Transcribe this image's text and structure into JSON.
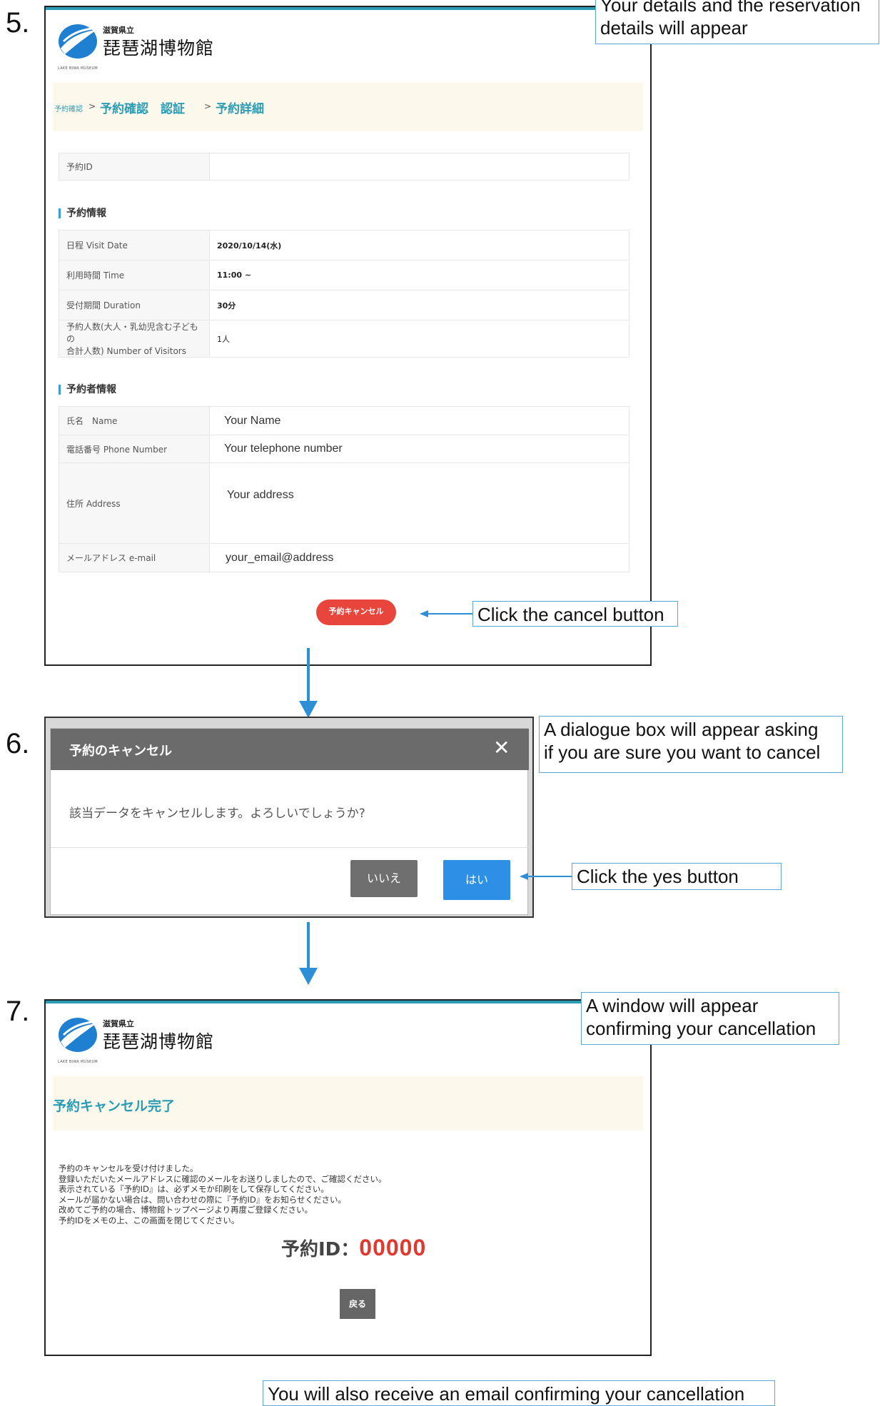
{
  "steps": {
    "s5": "5.",
    "s6": "6.",
    "s7": "7."
  },
  "callouts": {
    "details_1": "Your details and the reservation",
    "details_2": "details will appear",
    "cancel": "Click the cancel button",
    "dialogue_1": "A dialogue box will appear asking",
    "dialogue_2": "if you are sure you want to cancel",
    "yes": "Click the yes button",
    "window_1": "A window will appear",
    "window_2": "confirming your cancellation",
    "email": "You will also receive an email confirming your cancellation"
  },
  "logo": {
    "prefecture": "滋賀県立",
    "name": "琵琶湖博物館",
    "english": "LAKE BIWA MUSEUM"
  },
  "screen5": {
    "breadcrumb": {
      "small": "予約確認",
      "sep1": ">",
      "step1": "予約確認　認証",
      "sep2": ">",
      "step2": "予約詳細"
    },
    "id_label": "予約ID",
    "id_value": "",
    "reservation_title": "予約情報",
    "reservation_rows": [
      {
        "k": "日程 Visit Date",
        "v": "2020/10/14(水)"
      },
      {
        "k": "利用時間 Time",
        "v": "11:00 ~"
      },
      {
        "k": "受付期間 Duration",
        "v": "30分"
      },
      {
        "k1": "予約人数(大人・乳幼児含む子どもの",
        "k2": "合計人数) Number of Visitors",
        "v": "1人"
      }
    ],
    "booker_title": "予約者情報",
    "booker_rows": [
      {
        "k": "氏名　Name",
        "v": "Your Name"
      },
      {
        "k": "電話番号 Phone Number",
        "v": "Your telephone number"
      },
      {
        "k": "住所 Address",
        "v": "Your address"
      },
      {
        "k": "メールアドレス e-mail",
        "v": "your_email@address"
      }
    ],
    "cancel_button": "予約キャンセル"
  },
  "dialog": {
    "title": "予約のキャンセル",
    "message": "該当データをキャンセルします。よろしいでしょうか?",
    "no_button": "いいえ",
    "yes_button": "はい"
  },
  "screen7": {
    "title": "予約キャンセル完了",
    "lines": [
      "予約のキャンセルを受け付けました。",
      "登録いただいたメールアドレスに確認のメールをお送りしましたので、ご確認ください。",
      "表示されている『予約ID』は、必ずメモか印刷をして保存してください。",
      "メールが届かない場合は、問い合わせの際に『予約ID』をお知らせください。",
      "改めてご予約の場合、博物館トップページより再度ご登録ください。",
      "予約IDをメモの上、この画面を閉じてください。"
    ],
    "id_label": "予約ID：",
    "id_value": "00000",
    "back_button": "戻る"
  },
  "colors": {
    "accent": "#2a9cb3",
    "cancel_red": "#e8453c",
    "yes_blue": "#2d8fe6",
    "arrow_blue": "#2d8fd5"
  }
}
